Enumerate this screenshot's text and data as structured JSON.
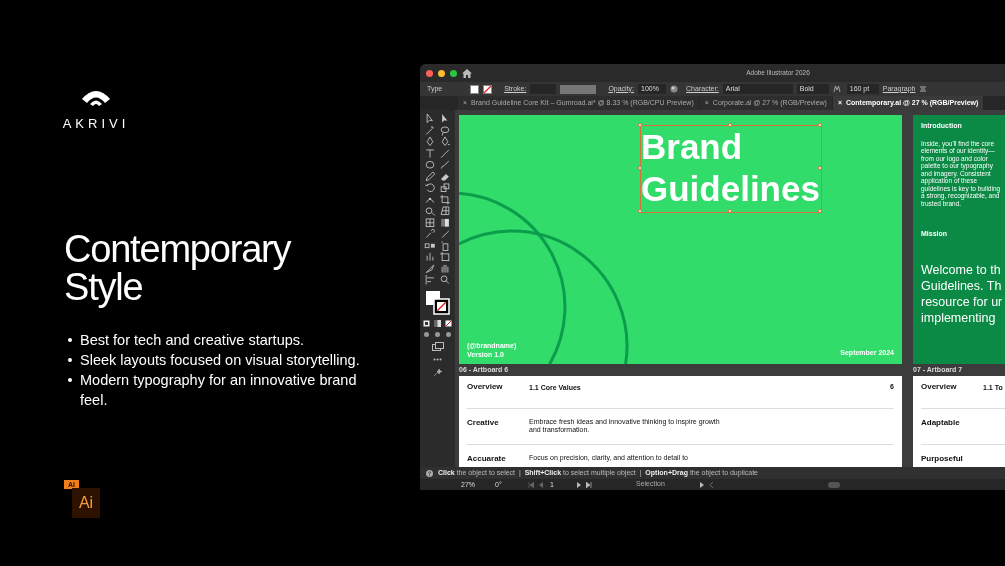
{
  "slide": {
    "logo": {
      "wordmark": "AKRIVI"
    },
    "headline": "Contemporary Style",
    "bullets": [
      "Best for tech and creative startups.",
      "Sleek layouts focused on visual storytelling.",
      "Modern typography for an innovative brand feel."
    ],
    "file_badge": {
      "tag": "AI",
      "label": "Ai"
    }
  },
  "app_window": {
    "title": "Adobe Illustrator 2026",
    "control_bar": {
      "object_type": "Type",
      "stroke_label": "Stroke:",
      "opacity_label": "Opacity:",
      "opacity": "100%",
      "character_label": "Character:",
      "font": "Arial",
      "font_style": "Bold",
      "font_size": "160 pt",
      "paragraph_label": "Paragraph"
    },
    "tabs": [
      {
        "label": "Brand Guideline Core Kit – Gumroad.ai* @ 8.33 % (RGB/CPU Preview)",
        "close": "×",
        "selected": false
      },
      {
        "label": "Corporate.ai @ 27 % (RGB/Preview)",
        "close": "×",
        "selected": false
      },
      {
        "label": "Contemporary.ai @ 27 % (RGB/Preview)",
        "close": "×",
        "selected": true
      }
    ],
    "top_artboards": [
      {
        "kind": "cover",
        "title": "Brand Guidelines",
        "title_selected": true,
        "handle": "(@brandname)",
        "version": "Version 1.0",
        "date": "September 2024"
      },
      {
        "kind": "intro",
        "heading": "Introduction",
        "body": "Inside, you'll find the core elements of our identity—from our logo and color palette to our typography and imagery. Consistent application of these guidelines is key to building a strong, recognizable, and trusted brand.",
        "mission_heading": "Mission",
        "mission_lines": [
          "Welcome to th",
          "Guidelines. Th",
          "resource for ur",
          "implementing"
        ]
      }
    ],
    "bottom_artboards": [
      {
        "label": "06 - Artboard 6",
        "kind": "values",
        "section": "Overview",
        "subtitle": "1.1 Core Values",
        "page": "6",
        "values": [
          {
            "name": "Creative",
            "text": "Embrace fresh ideas and innovative thinking to inspire growth and transformation."
          },
          {
            "name": "Accuarate",
            "text": "Focus on precision, clarity, and attention to detail to"
          }
        ]
      },
      {
        "label": "07 - Artboard 7",
        "kind": "values",
        "section": "Overview",
        "subtitle": "1.1 To",
        "values": [
          {
            "name": "Adaptable"
          },
          {
            "name": "Purposeful"
          }
        ]
      }
    ],
    "status_hint": "**Click** the object to select  |  **Shift+Click** to select multiple object  |  **Option+Drag** the object to duplicate",
    "bottom_bar": {
      "zoom": "27%",
      "rotation": "0°",
      "artboard_number": "1",
      "tool": "Selection"
    }
  }
}
